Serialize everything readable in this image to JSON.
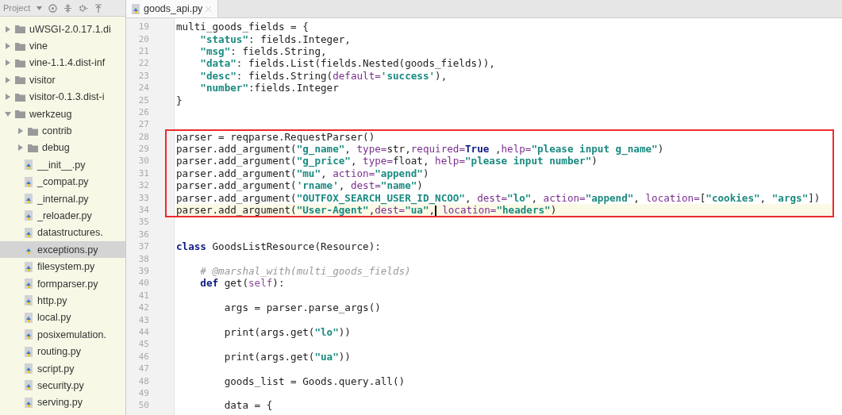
{
  "project_panel": {
    "title": "Project",
    "tree": [
      {
        "name": "uWSGI-2.0.17.1.di",
        "kind": "folder",
        "expanded": false,
        "selected": false
      },
      {
        "name": "vine",
        "kind": "folder",
        "expanded": false,
        "selected": false
      },
      {
        "name": "vine-1.1.4.dist-inf",
        "kind": "folder",
        "expanded": false,
        "selected": false
      },
      {
        "name": "visitor",
        "kind": "folder",
        "expanded": false,
        "selected": false
      },
      {
        "name": "visitor-0.1.3.dist-i",
        "kind": "folder",
        "expanded": false,
        "selected": false
      },
      {
        "name": "werkzeug",
        "kind": "folder",
        "expanded": true,
        "selected": false,
        "children": [
          {
            "name": "contrib",
            "kind": "folder",
            "expanded": false,
            "selected": false
          },
          {
            "name": "debug",
            "kind": "folder",
            "expanded": false,
            "selected": false
          },
          {
            "name": "__init__.py",
            "kind": "file",
            "selected": false
          },
          {
            "name": "_compat.py",
            "kind": "file",
            "selected": false
          },
          {
            "name": "_internal.py",
            "kind": "file",
            "selected": false
          },
          {
            "name": "_reloader.py",
            "kind": "file",
            "selected": false
          },
          {
            "name": "datastructures.",
            "kind": "file",
            "selected": false
          },
          {
            "name": "exceptions.py",
            "kind": "file",
            "selected": true
          },
          {
            "name": "filesystem.py",
            "kind": "file",
            "selected": false
          },
          {
            "name": "formparser.py",
            "kind": "file",
            "selected": false
          },
          {
            "name": "http.py",
            "kind": "file",
            "selected": false
          },
          {
            "name": "local.py",
            "kind": "file",
            "selected": false
          },
          {
            "name": "posixemulation.",
            "kind": "file",
            "selected": false
          },
          {
            "name": "routing.py",
            "kind": "file",
            "selected": false
          },
          {
            "name": "script.py",
            "kind": "file",
            "selected": false
          },
          {
            "name": "security.py",
            "kind": "file",
            "selected": false
          },
          {
            "name": "serving.py",
            "kind": "file",
            "selected": false
          }
        ]
      }
    ]
  },
  "editor": {
    "tabs": [
      {
        "label": "goods_api.py",
        "selected": true
      }
    ],
    "blocks": [
      {
        "boxed": false,
        "lines": [
          {
            "number": "19",
            "current": false,
            "tokens": [
              {
                "kind": "plain",
                "text": "multi_goods_fields = {"
              }
            ]
          },
          {
            "number": "20",
            "current": false,
            "tokens": [
              {
                "kind": "string",
                "text": "    \"status\""
              },
              {
                "kind": "plain",
                "text": ": fields.Integer,"
              }
            ]
          },
          {
            "number": "21",
            "current": false,
            "tokens": [
              {
                "kind": "string",
                "text": "    \"msg\""
              },
              {
                "kind": "plain",
                "text": ": fields.String,"
              }
            ]
          },
          {
            "number": "22",
            "current": false,
            "tokens": [
              {
                "kind": "string",
                "text": "    \"data\""
              },
              {
                "kind": "plain",
                "text": ": fields.List(fields.Nested(goods_fields)),"
              }
            ]
          },
          {
            "number": "23",
            "current": false,
            "tokens": [
              {
                "kind": "string",
                "text": "    \"desc\""
              },
              {
                "kind": "plain",
                "text": ": fields.String("
              },
              {
                "kind": "param",
                "text": "default="
              },
              {
                "kind": "string",
                "text": "'success'"
              },
              {
                "kind": "plain",
                "text": "),"
              }
            ]
          },
          {
            "number": "24",
            "current": false,
            "tokens": [
              {
                "kind": "string",
                "text": "    \"number\""
              },
              {
                "kind": "plain",
                "text": ":fields.Integer"
              }
            ]
          },
          {
            "number": "25",
            "current": false,
            "tokens": [
              {
                "kind": "plain",
                "text": "}"
              }
            ]
          },
          {
            "number": "26",
            "current": false
          },
          {
            "number": "27",
            "current": false
          }
        ]
      },
      {
        "boxed": true,
        "lines": [
          {
            "number": "28",
            "current": false,
            "tokens": [
              {
                "kind": "plain",
                "text": "parser = reqparse.RequestParser()"
              }
            ]
          },
          {
            "number": "29",
            "current": false,
            "tokens": [
              {
                "kind": "plain",
                "text": "parser.add_argument("
              },
              {
                "kind": "string",
                "text": "\"g_name\""
              },
              {
                "kind": "plain",
                "text": ", "
              },
              {
                "kind": "param",
                "text": "type="
              },
              {
                "kind": "plain",
                "text": "str,"
              },
              {
                "kind": "param",
                "text": "required="
              },
              {
                "kind": "keyword",
                "text": "True"
              },
              {
                "kind": "plain",
                "text": " ,"
              },
              {
                "kind": "param",
                "text": "help="
              },
              {
                "kind": "string",
                "text": "\"please input g_name\""
              },
              {
                "kind": "plain",
                "text": ")"
              }
            ]
          },
          {
            "number": "30",
            "current": false,
            "tokens": [
              {
                "kind": "plain",
                "text": "parser.add_argument("
              },
              {
                "kind": "string",
                "text": "\"g_price\""
              },
              {
                "kind": "plain",
                "text": ", "
              },
              {
                "kind": "param",
                "text": "type="
              },
              {
                "kind": "plain",
                "text": "float, "
              },
              {
                "kind": "param",
                "text": "help="
              },
              {
                "kind": "string",
                "text": "\"please input number\""
              },
              {
                "kind": "plain",
                "text": ")"
              }
            ]
          },
          {
            "number": "31",
            "current": false,
            "tokens": [
              {
                "kind": "plain",
                "text": "parser.add_argument("
              },
              {
                "kind": "string",
                "text": "\"mu\""
              },
              {
                "kind": "plain",
                "text": ", "
              },
              {
                "kind": "param",
                "text": "action="
              },
              {
                "kind": "string",
                "text": "\"append\""
              },
              {
                "kind": "plain",
                "text": ")"
              }
            ]
          },
          {
            "number": "32",
            "current": false,
            "tokens": [
              {
                "kind": "plain",
                "text": "parser.add_argument("
              },
              {
                "kind": "string",
                "text": "'rname'"
              },
              {
                "kind": "plain",
                "text": ", "
              },
              {
                "kind": "param",
                "text": "dest="
              },
              {
                "kind": "string",
                "text": "\"name\""
              },
              {
                "kind": "plain",
                "text": ")"
              }
            ]
          },
          {
            "number": "33",
            "current": false,
            "tokens": [
              {
                "kind": "plain",
                "text": "parser.add_argument("
              },
              {
                "kind": "string",
                "text": "\"OUTFOX_SEARCH_USER_ID_NCOO\""
              },
              {
                "kind": "plain",
                "text": ", "
              },
              {
                "kind": "param",
                "text": "dest="
              },
              {
                "kind": "string",
                "text": "\"lo\""
              },
              {
                "kind": "plain",
                "text": ", "
              },
              {
                "kind": "param",
                "text": "action="
              },
              {
                "kind": "string",
                "text": "\"append\""
              },
              {
                "kind": "plain",
                "text": ", "
              },
              {
                "kind": "param",
                "text": "location="
              },
              {
                "kind": "plain",
                "text": "["
              },
              {
                "kind": "string",
                "text": "\"cookies\""
              },
              {
                "kind": "plain",
                "text": ", "
              },
              {
                "kind": "string",
                "text": "\"args\""
              },
              {
                "kind": "plain",
                "text": "])"
              }
            ]
          },
          {
            "number": "34",
            "current": true,
            "tokens": [
              {
                "kind": "plain",
                "text": "parser.add_argument("
              },
              {
                "kind": "string",
                "text": "\"User-Agent\""
              },
              {
                "kind": "plain",
                "text": ","
              },
              {
                "kind": "param",
                "text": "dest="
              },
              {
                "kind": "string",
                "text": "\"ua\""
              },
              {
                "kind": "plain",
                "text": ","
              },
              {
                "kind": "cursor"
              },
              {
                "kind": "param",
                "text": " location="
              },
              {
                "kind": "string",
                "text": "\"headers\""
              },
              {
                "kind": "plain",
                "text": ")"
              }
            ]
          }
        ]
      },
      {
        "boxed": false,
        "lines": [
          {
            "number": "35",
            "current": false
          },
          {
            "number": "36",
            "current": false
          },
          {
            "number": "37",
            "current": false,
            "tokens": [
              {
                "kind": "keyword",
                "text": "class"
              },
              {
                "kind": "plain",
                "text": " GoodsListResource(Resource):"
              }
            ]
          },
          {
            "number": "38",
            "current": false
          },
          {
            "number": "39",
            "current": false,
            "tokens": [
              {
                "kind": "comment",
                "text": "    # @marshal_with(multi_goods_fields)"
              }
            ]
          },
          {
            "number": "40",
            "current": false,
            "tokens": [
              {
                "kind": "keyword",
                "text": "    def"
              },
              {
                "kind": "plain",
                "text": " get("
              },
              {
                "kind": "self",
                "text": "self"
              },
              {
                "kind": "plain",
                "text": "):"
              }
            ]
          },
          {
            "number": "41",
            "current": false
          },
          {
            "number": "42",
            "current": false,
            "tokens": [
              {
                "kind": "plain",
                "text": "        args = parser.parse_args()"
              }
            ]
          },
          {
            "number": "43",
            "current": false
          },
          {
            "number": "44",
            "current": false,
            "tokens": [
              {
                "kind": "plain",
                "text": "        print(args.get("
              },
              {
                "kind": "string",
                "text": "\"lo\""
              },
              {
                "kind": "plain",
                "text": "))"
              }
            ]
          },
          {
            "number": "45",
            "current": false
          },
          {
            "number": "46",
            "current": false,
            "tokens": [
              {
                "kind": "plain",
                "text": "        print(args.get("
              },
              {
                "kind": "string",
                "text": "\"ua\""
              },
              {
                "kind": "plain",
                "text": "))"
              }
            ]
          },
          {
            "number": "47",
            "current": false
          },
          {
            "number": "48",
            "current": false,
            "tokens": [
              {
                "kind": "plain",
                "text": "        goods_list = Goods.query.all()"
              }
            ]
          },
          {
            "number": "49",
            "current": false
          },
          {
            "number": "50",
            "current": false,
            "tokens": [
              {
                "kind": "plain",
                "text": "        data = {"
              }
            ]
          }
        ]
      }
    ]
  }
}
